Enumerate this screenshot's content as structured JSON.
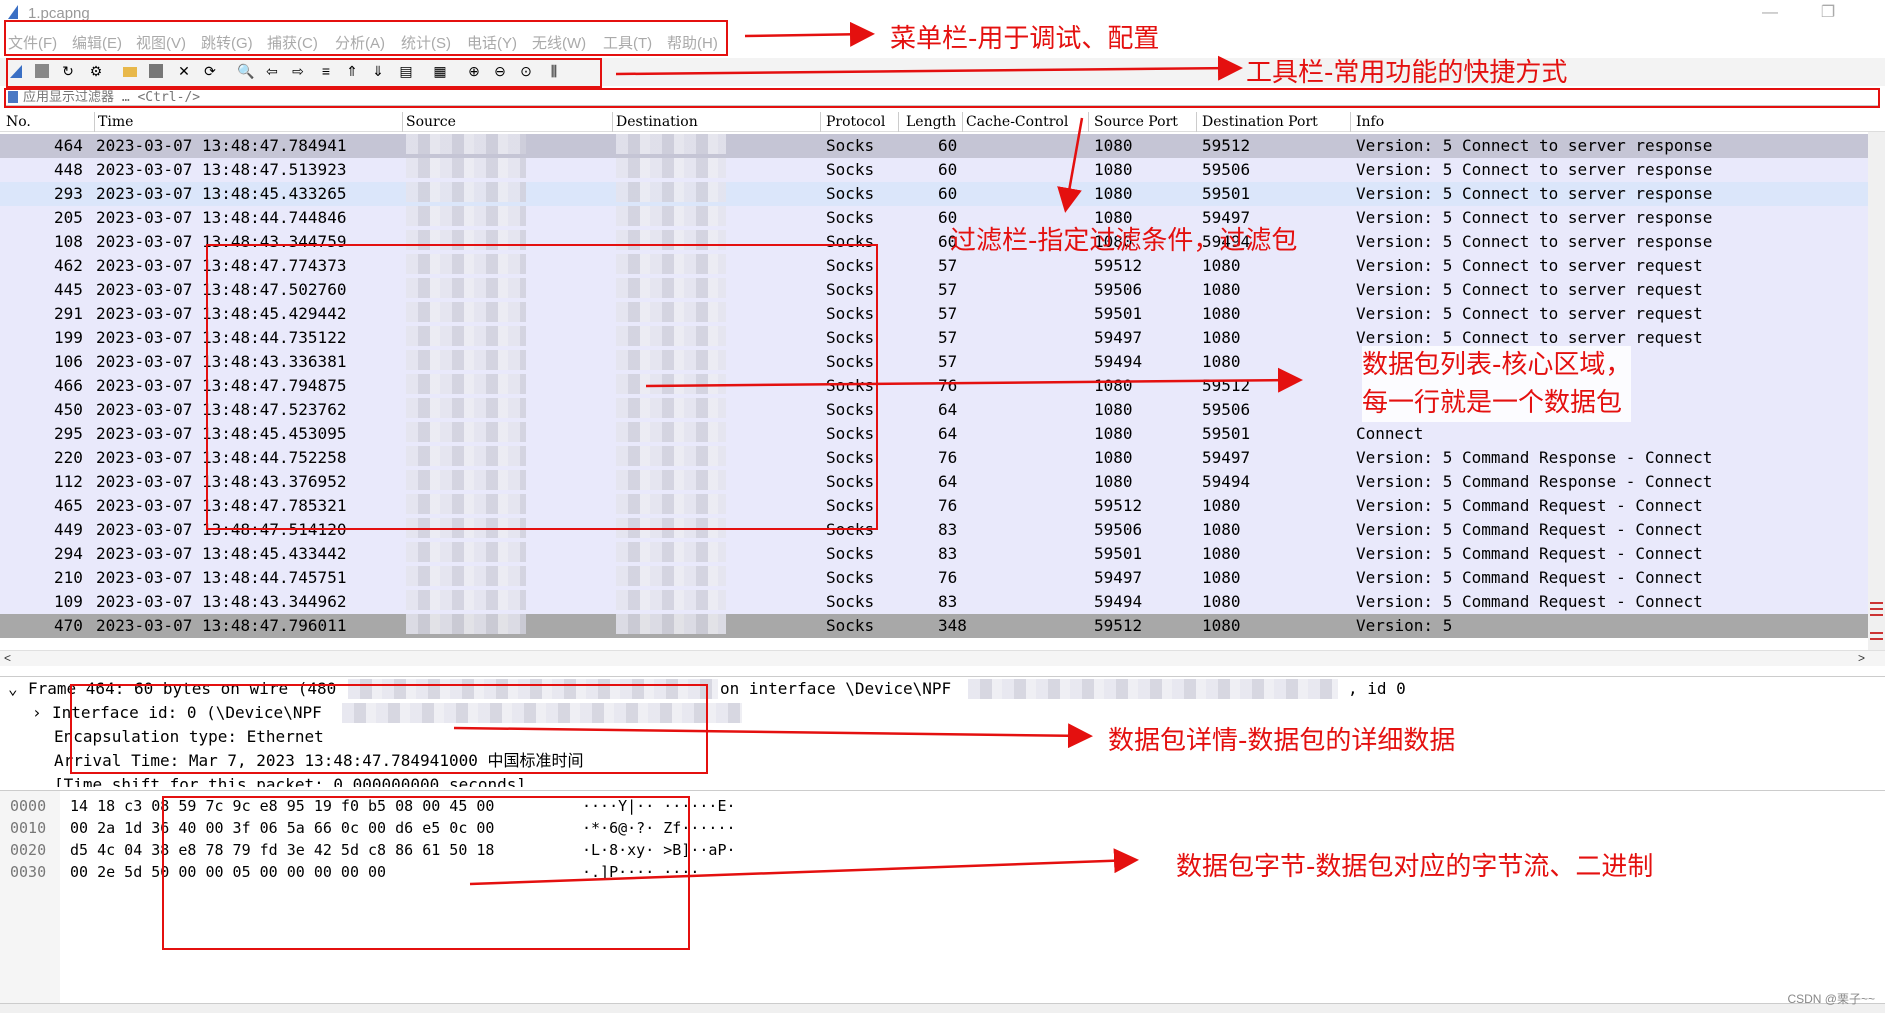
{
  "window": {
    "title": "1.pcapng",
    "btn_min": "—",
    "btn_restore": "❐"
  },
  "menu": [
    {
      "label": "文件(F)"
    },
    {
      "label": "编辑(E)"
    },
    {
      "label": "视图(V)"
    },
    {
      "label": "跳转(G)"
    },
    {
      "label": "捕获(C)"
    },
    {
      "label": "分析(A)"
    },
    {
      "label": "统计(S)"
    },
    {
      "label": "电话(Y)"
    },
    {
      "label": "无线(W)"
    },
    {
      "label": "工具(T)"
    },
    {
      "label": "帮助(H)"
    }
  ],
  "toolbar_icons": [
    "shark-fin-icon",
    "stop-icon",
    "restart-icon",
    "options-gear-icon",
    "open-folder-icon",
    "save-icon",
    "close-file-icon",
    "reload-icon",
    "find-icon",
    "back-icon",
    "forward-icon",
    "goto-packet-icon",
    "first-packet-icon",
    "last-packet-icon",
    "autoscroll-icon",
    "colorize-icon",
    "zoom-in-icon",
    "zoom-out-icon",
    "normal-size-icon",
    "resize-columns-icon"
  ],
  "filter": {
    "placeholder": "应用显示过滤器 … <Ctrl-/>"
  },
  "columns": {
    "no": "No.",
    "time": "Time",
    "source": "Source",
    "destination": "Destination",
    "protocol": "Protocol",
    "length": "Length",
    "cache": "Cache-Control",
    "srcport": "Source Port",
    "dstport": "Destination Port",
    "info": "Info"
  },
  "packets": [
    {
      "no": "464",
      "time": "2023-03-07 13:48:47.784941",
      "protocol": "Socks",
      "length": "60",
      "srcport": "1080",
      "dstport": "59512",
      "info": "Version: 5 Connect to server response"
    },
    {
      "no": "448",
      "time": "2023-03-07 13:48:47.513923",
      "protocol": "Socks",
      "length": "60",
      "srcport": "1080",
      "dstport": "59506",
      "info": "Version: 5 Connect to server response"
    },
    {
      "no": "293",
      "time": "2023-03-07 13:48:45.433265",
      "protocol": "Socks",
      "length": "60",
      "srcport": "1080",
      "dstport": "59501",
      "info": "Version: 5 Connect to server response"
    },
    {
      "no": "205",
      "time": "2023-03-07 13:48:44.744846",
      "protocol": "Socks",
      "length": "60",
      "srcport": "1080",
      "dstport": "59497",
      "info": "Version: 5 Connect to server response"
    },
    {
      "no": "108",
      "time": "2023-03-07 13:48:43.344759",
      "protocol": "Socks",
      "length": "60",
      "srcport": "1080",
      "dstport": "59494",
      "info": "Version: 5 Connect to server response"
    },
    {
      "no": "462",
      "time": "2023-03-07 13:48:47.774373",
      "protocol": "Socks",
      "length": "57",
      "srcport": "59512",
      "dstport": "1080",
      "info": "Version: 5 Connect to server request"
    },
    {
      "no": "445",
      "time": "2023-03-07 13:48:47.502760",
      "protocol": "Socks",
      "length": "57",
      "srcport": "59506",
      "dstport": "1080",
      "info": "Version: 5 Connect to server request"
    },
    {
      "no": "291",
      "time": "2023-03-07 13:48:45.429442",
      "protocol": "Socks",
      "length": "57",
      "srcport": "59501",
      "dstport": "1080",
      "info": "Version: 5 Connect to server request"
    },
    {
      "no": "199",
      "time": "2023-03-07 13:48:44.735122",
      "protocol": "Socks",
      "length": "57",
      "srcport": "59497",
      "dstport": "1080",
      "info": "Version: 5 Connect to server request"
    },
    {
      "no": "106",
      "time": "2023-03-07 13:48:43.336381",
      "protocol": "Socks",
      "length": "57",
      "srcport": "59494",
      "dstport": "1080",
      "info": ""
    },
    {
      "no": "466",
      "time": "2023-03-07 13:48:47.794875",
      "protocol": "Socks",
      "length": "76",
      "srcport": "1080",
      "dstport": "59512",
      "info": ""
    },
    {
      "no": "450",
      "time": "2023-03-07 13:48:47.523762",
      "protocol": "Socks",
      "length": "64",
      "srcport": "1080",
      "dstport": "59506",
      "info": ""
    },
    {
      "no": "295",
      "time": "2023-03-07 13:48:45.453095",
      "protocol": "Socks",
      "length": "64",
      "srcport": "1080",
      "dstport": "59501",
      "info": "Connect"
    },
    {
      "no": "220",
      "time": "2023-03-07 13:48:44.752258",
      "protocol": "Socks",
      "length": "76",
      "srcport": "1080",
      "dstport": "59497",
      "info": "Version: 5 Command Response - Connect"
    },
    {
      "no": "112",
      "time": "2023-03-07 13:48:43.376952",
      "protocol": "Socks",
      "length": "64",
      "srcport": "1080",
      "dstport": "59494",
      "info": "Version: 5 Command Response - Connect"
    },
    {
      "no": "465",
      "time": "2023-03-07 13:48:47.785321",
      "protocol": "Socks",
      "length": "76",
      "srcport": "59512",
      "dstport": "1080",
      "info": "Version: 5 Command Request - Connect"
    },
    {
      "no": "449",
      "time": "2023-03-07 13:48:47.514120",
      "protocol": "Socks",
      "length": "83",
      "srcport": "59506",
      "dstport": "1080",
      "info": "Version: 5 Command Request - Connect"
    },
    {
      "no": "294",
      "time": "2023-03-07 13:48:45.433442",
      "protocol": "Socks",
      "length": "83",
      "srcport": "59501",
      "dstport": "1080",
      "info": "Version: 5 Command Request - Connect"
    },
    {
      "no": "210",
      "time": "2023-03-07 13:48:44.745751",
      "protocol": "Socks",
      "length": "76",
      "srcport": "59497",
      "dstport": "1080",
      "info": "Version: 5 Command Request - Connect"
    },
    {
      "no": "109",
      "time": "2023-03-07 13:48:43.344962",
      "protocol": "Socks",
      "length": "83",
      "srcport": "59494",
      "dstport": "1080",
      "info": "Version: 5 Command Request - Connect"
    },
    {
      "no": "470",
      "time": "2023-03-07 13:48:47.796011",
      "protocol": "Socks",
      "length": "348",
      "srcport": "59512",
      "dstport": "1080",
      "info": "Version: 5"
    }
  ],
  "row_colors": {
    "selected": "#c5c5d5",
    "default": "#e9e9fb",
    "highlight": "#dbe6fa",
    "dark": "#a8a8a8"
  },
  "details": {
    "frame": "Frame 464: 60 bytes on wire (480",
    "frame_tail1": "on interface \\Device\\NPF",
    "frame_tail2": ", id 0",
    "interface": "Interface id: 0 (\\Device\\NPF",
    "encap": "Encapsulation type: Ethernet",
    "arrival": "Arrival Time: Mar  7, 2023 13:48:47.784941000 中国标准时间",
    "shift": "[Time shift for this packet: 0.000000000 seconds]"
  },
  "bytes": [
    {
      "off": "0000",
      "hex": "14 18 c3 08 59 7c 9c e8  95 19 f0 b5 08 00 45 00",
      "asc": "····Y|·· ······E·"
    },
    {
      "off": "0010",
      "hex": "00 2a 1d 36 40 00 3f 06  5a 66 0c 00 d6 e5 0c 00",
      "asc": "·*·6@·?· Zf······"
    },
    {
      "off": "0020",
      "hex": "d5 4c 04 38 e8 78 79 fd  3e 42 5d c8 86 61 50 18",
      "asc": "·L·8·xy· >B]··aP·"
    },
    {
      "off": "0030",
      "hex": "00 2e 5d 50 00 00 05 00  00 00 00 00",
      "asc": "·.]P···· ····"
    }
  ],
  "annotations": {
    "menubar": "菜单栏-用于调试、配置",
    "toolbar": "工具栏-常用功能的快捷方式",
    "filter": "过滤栏-指定过滤条件，过滤包",
    "list": "数据包列表-核心区域，\n每一行就是一个数据包",
    "details": "数据包详情-数据包的详细数据",
    "bytes": "数据包字节-数据包对应的字节流、二进制"
  },
  "watermark": "CSDN @栗子~~"
}
